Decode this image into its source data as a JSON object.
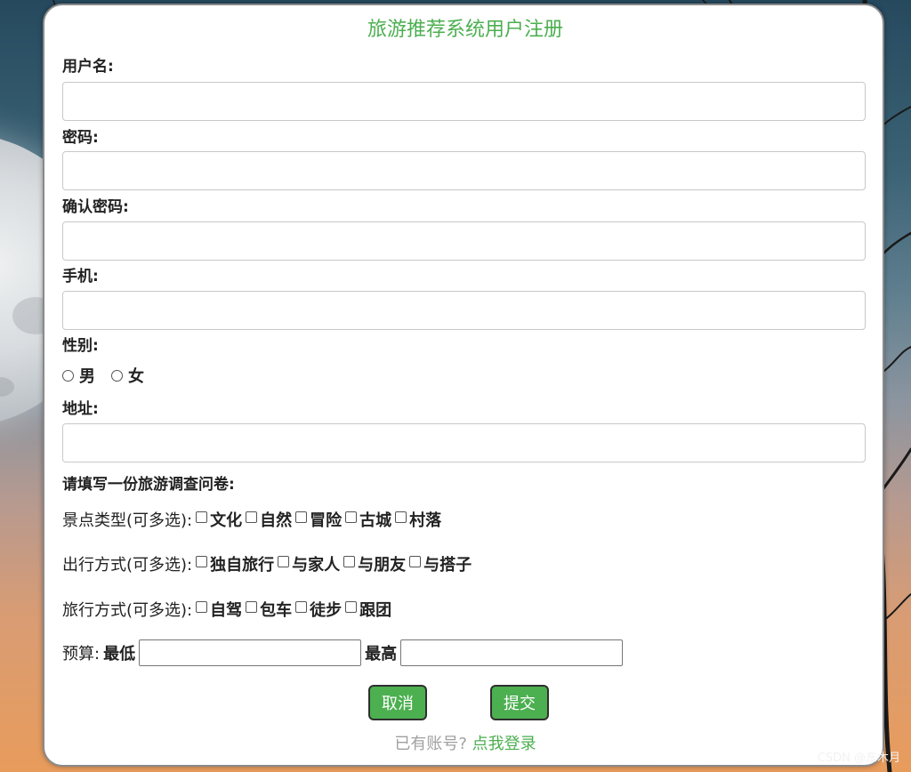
{
  "form": {
    "title": "旅游推荐系统用户注册",
    "username_label": "用户名:",
    "password_label": "密码:",
    "confirm_password_label": "确认密码:",
    "phone_label": "手机:",
    "gender_label": "性别:",
    "gender_options": [
      "男",
      "女"
    ],
    "address_label": "地址:",
    "survey_title": "请填写一份旅游调查问卷:",
    "scenery": {
      "prefix": "景点类型(可多选):",
      "options": [
        "文化",
        "自然",
        "冒险",
        "古城",
        "村落"
      ]
    },
    "travel_company": {
      "prefix": "出行方式(可多选):",
      "options": [
        "独自旅行",
        "与家人",
        "与朋友",
        "与搭子"
      ]
    },
    "travel_mode": {
      "prefix": "旅行方式(可多选):",
      "options": [
        "自驾",
        "包车",
        "徒步",
        "跟团"
      ]
    },
    "budget": {
      "prefix": "预算:",
      "min_label": "最低",
      "max_label": "最高"
    },
    "cancel_label": "取消",
    "submit_label": "提交",
    "login_prompt": "已有账号?",
    "login_link": "点我登录"
  },
  "watermark": "CSDN @东木月",
  "colors": {
    "accent": "#4caf50",
    "muted_text": "#a0a0a0"
  }
}
